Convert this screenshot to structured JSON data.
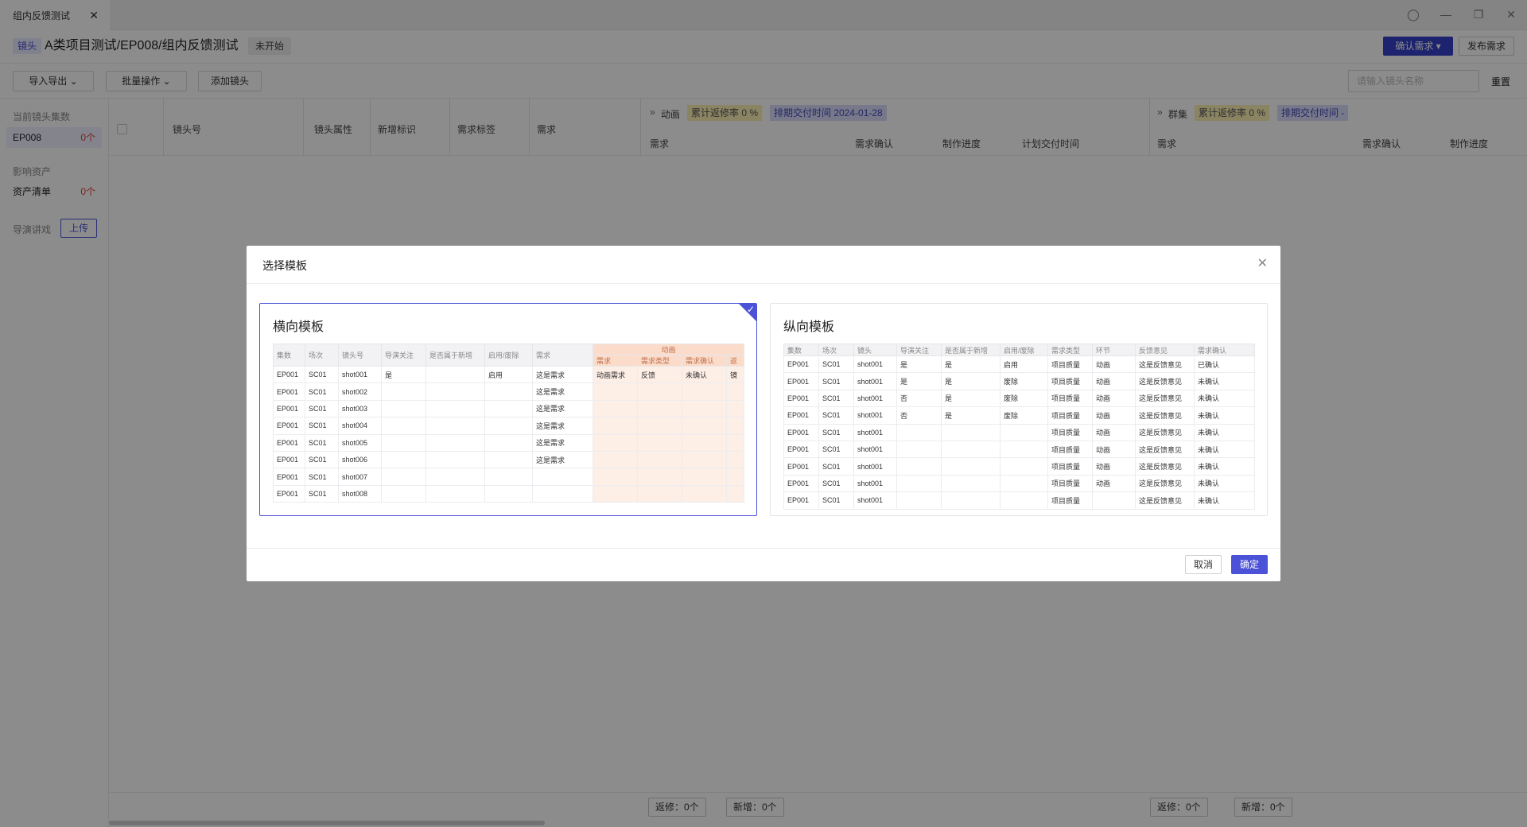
{
  "window": {
    "tab_title": "组内反馈测试",
    "tab_close": "✕",
    "controls": [
      "◯",
      "—",
      "❐",
      "✕"
    ]
  },
  "header": {
    "lens_badge": "镜头",
    "breadcrumb": "A类项目测试/EP008/组内反馈测试",
    "status": "未开始",
    "confirm_btn": "确认需求 ▾",
    "publish_btn": "发布需求"
  },
  "toolbar": {
    "import_export": "导入导出 ⌄",
    "batch": "批量操作 ⌄",
    "add_lens": "添加镜头",
    "search_placeholder": "请输入镜头名称",
    "reset": "重置"
  },
  "sidebar": {
    "section1_label": "当前镜头集数",
    "item1_name": "EP008",
    "item1_count": "0个",
    "section2_label": "影响资产",
    "item2_name": "资产清单",
    "item2_count": "0个",
    "section3_label": "导演讲戏",
    "upload": "上传"
  },
  "table_header": {
    "col_shot": "镜头号",
    "col_attr": "镜头属性",
    "col_new_flag": "新增标识",
    "col_req_tag": "需求标签",
    "col_req": "需求",
    "group1": {
      "arrow": "»",
      "name": "动画",
      "rework": "累计返修率 0 %",
      "delivery": "排期交付时间 2024-01-28",
      "cols": [
        "需求",
        "需求确认",
        "制作进度",
        "计划交付时间"
      ]
    },
    "group2": {
      "arrow": "»",
      "name": "群集",
      "rework": "累计返修率 0 %",
      "delivery": "排期交付时间 -",
      "cols": [
        "需求",
        "需求确认",
        "制作进度"
      ]
    }
  },
  "bottom": {
    "g1_rework": "返修：0个",
    "g1_new": "新增：0个",
    "g2_rework": "返修：0个",
    "g2_new": "新增：0个"
  },
  "modal": {
    "title": "选择模板",
    "close": "✕",
    "cancel": "取消",
    "ok": "确定",
    "horizontal": {
      "title": "横向模板",
      "check": "✓",
      "group_label": "动画",
      "headers": [
        "集数",
        "场次",
        "镜头号",
        "导演关注",
        "是否属于新增",
        "启用/废除",
        "需求"
      ],
      "sub_headers": [
        "需求",
        "需求类型",
        "需求确认",
        "返"
      ],
      "rows": [
        [
          "EP001",
          "SC01",
          "shot001",
          "是",
          "",
          "启用",
          "这是需求",
          "动画需求",
          "反馈",
          "未确认",
          "镜"
        ],
        [
          "EP001",
          "SC01",
          "shot002",
          "",
          "",
          "",
          "这是需求",
          "",
          "",
          "",
          ""
        ],
        [
          "EP001",
          "SC01",
          "shot003",
          "",
          "",
          "",
          "这是需求",
          "",
          "",
          "",
          ""
        ],
        [
          "EP001",
          "SC01",
          "shot004",
          "",
          "",
          "",
          "这是需求",
          "",
          "",
          "",
          ""
        ],
        [
          "EP001",
          "SC01",
          "shot005",
          "",
          "",
          "",
          "这是需求",
          "",
          "",
          "",
          ""
        ],
        [
          "EP001",
          "SC01",
          "shot006",
          "",
          "",
          "",
          "这是需求",
          "",
          "",
          "",
          ""
        ],
        [
          "EP001",
          "SC01",
          "shot007",
          "",
          "",
          "",
          "",
          "",
          "",
          "",
          ""
        ],
        [
          "EP001",
          "SC01",
          "shot008",
          "",
          "",
          "",
          "",
          "",
          "",
          "",
          ""
        ]
      ]
    },
    "vertical": {
      "title": "纵向模板",
      "headers": [
        "集数",
        "场次",
        "镜头",
        "导演关注",
        "是否属于新增",
        "启用/废除",
        "需求类型",
        "环节",
        "反馈意见",
        "需求确认"
      ],
      "rows": [
        [
          "EP001",
          "SC01",
          "shot001",
          "是",
          "是",
          "启用",
          "项目质量",
          "动画",
          "这是反馈意见",
          "已确认"
        ],
        [
          "EP001",
          "SC01",
          "shot001",
          "是",
          "是",
          "废除",
          "项目质量",
          "动画",
          "这是反馈意见",
          "未确认"
        ],
        [
          "EP001",
          "SC01",
          "shot001",
          "否",
          "是",
          "废除",
          "项目质量",
          "动画",
          "这是反馈意见",
          "未确认"
        ],
        [
          "EP001",
          "SC01",
          "shot001",
          "否",
          "是",
          "废除",
          "项目质量",
          "动画",
          "这是反馈意见",
          "未确认"
        ],
        [
          "EP001",
          "SC01",
          "shot001",
          "",
          "",
          "",
          "项目质量",
          "动画",
          "这是反馈意见",
          "未确认"
        ],
        [
          "EP001",
          "SC01",
          "shot001",
          "",
          "",
          "",
          "项目质量",
          "动画",
          "这是反馈意见",
          "未确认"
        ],
        [
          "EP001",
          "SC01",
          "shot001",
          "",
          "",
          "",
          "项目质量",
          "动画",
          "这是反馈意见",
          "未确认"
        ],
        [
          "EP001",
          "SC01",
          "shot001",
          "",
          "",
          "",
          "项目质量",
          "动画",
          "这是反馈意见",
          "未确认"
        ],
        [
          "EP001",
          "SC01",
          "shot001",
          "",
          "",
          "",
          "项目质量",
          "",
          "这是反馈意见",
          "未确认"
        ]
      ]
    }
  }
}
